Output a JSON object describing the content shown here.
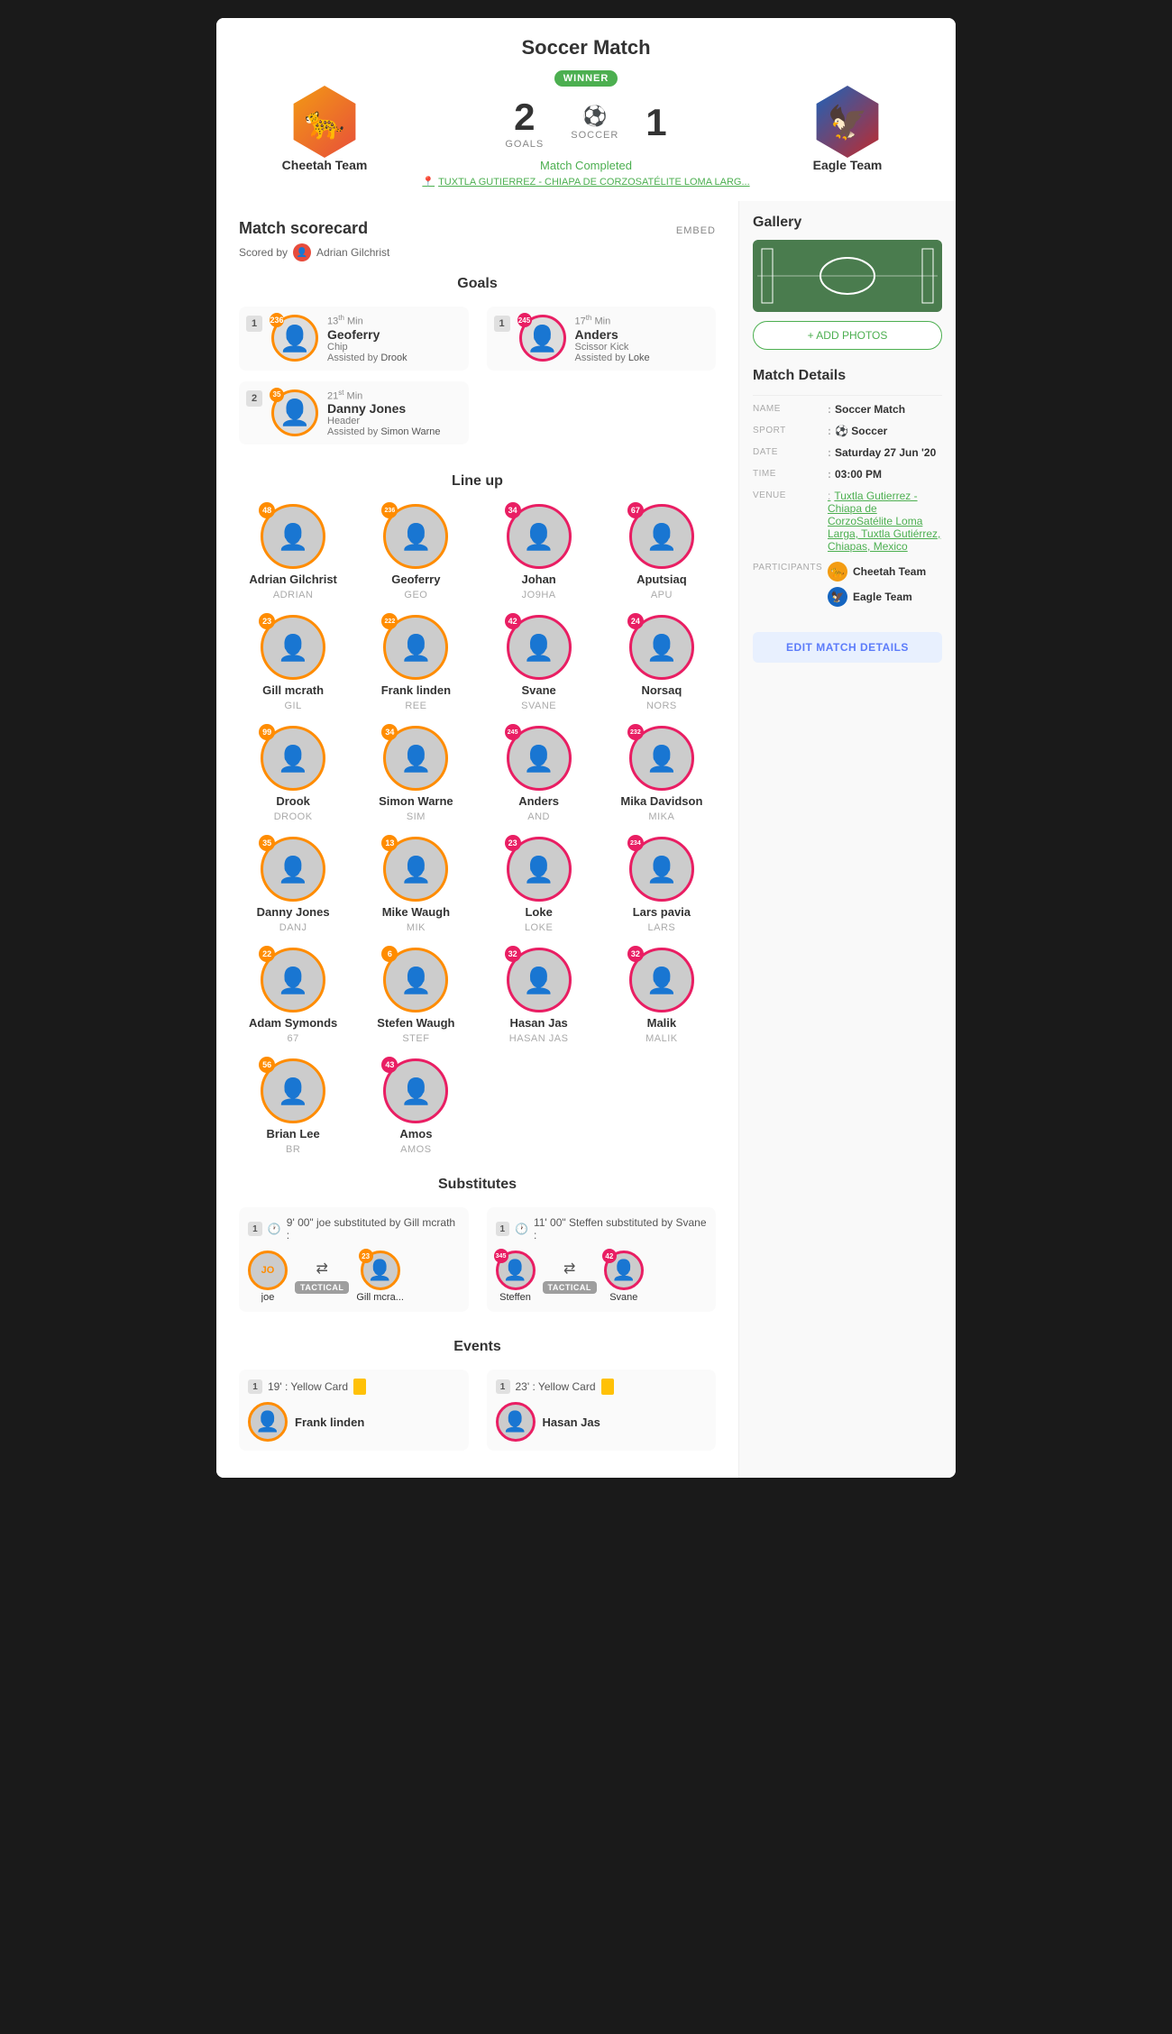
{
  "header": {
    "title": "Soccer Match",
    "team_left": {
      "name": "Cheetah Team",
      "score": "2",
      "goals_label": "GOALS",
      "winner": true,
      "winner_badge": "WINNER"
    },
    "team_right": {
      "name": "Eagle Team",
      "score": "1"
    },
    "sport": "SOCCER",
    "status": "Match Completed",
    "location": "TUXTLA GUTIERREZ - CHIAPA DE CORZOSATÉLITE LOMA LARG...",
    "embed_label": "EMBED"
  },
  "scorecard": {
    "title": "Match scorecard",
    "scored_by_label": "Scored by",
    "scored_by_name": "Adrian Gilchrist",
    "goals_title": "Goals",
    "goals_left": [
      {
        "number": "1",
        "player_num": "236",
        "player_name": "Geoferry",
        "min": "13",
        "min_sup": "th",
        "type": "Chip",
        "assist_label": "Assisted by",
        "assist": "Drook"
      },
      {
        "number": "2",
        "player_num": "35",
        "player_name": "Danny Jones",
        "min": "21",
        "min_sup": "st",
        "type": "Header",
        "assist_label": "Assisted by",
        "assist": "Simon Warne"
      }
    ],
    "goals_right": [
      {
        "number": "1",
        "player_num": "245",
        "player_name": "Anders",
        "min": "17",
        "min_sup": "th",
        "type": "Scissor Kick",
        "assist_label": "Assisted by",
        "assist": "Loke"
      }
    ],
    "lineup_title": "Line up",
    "players": [
      {
        "name": "Adrian Gilchrist",
        "code": "ADRIAN",
        "num": "48",
        "type": "orange"
      },
      {
        "name": "Geoferry",
        "code": "GEO",
        "num": "236",
        "type": "orange"
      },
      {
        "name": "Johan",
        "code": "JO9HA",
        "num": "34",
        "type": "pink"
      },
      {
        "name": "Aputsiaq",
        "code": "APU",
        "num": "67",
        "type": "pink"
      },
      {
        "name": "Gill mcrath",
        "code": "GIL",
        "num": "23",
        "type": "orange"
      },
      {
        "name": "Frank linden",
        "code": "REE",
        "num": "222",
        "type": "orange"
      },
      {
        "name": "Svane",
        "code": "SVANE",
        "num": "42",
        "type": "pink"
      },
      {
        "name": "Norsaq",
        "code": "NORS",
        "num": "24",
        "type": "pink"
      },
      {
        "name": "Drook",
        "code": "DROOK",
        "num": "99",
        "type": "orange"
      },
      {
        "name": "Simon Warne",
        "code": "SIM",
        "num": "34",
        "type": "orange"
      },
      {
        "name": "Anders",
        "code": "AND",
        "num": "245",
        "type": "pink"
      },
      {
        "name": "Mika Davidson",
        "code": "MIKA",
        "num": "232",
        "type": "pink"
      },
      {
        "name": "Danny Jones",
        "code": "DANJ",
        "num": "35",
        "type": "orange"
      },
      {
        "name": "Mike Waugh",
        "code": "MIK",
        "num": "13",
        "type": "orange"
      },
      {
        "name": "Loke",
        "code": "LOKE",
        "num": "23",
        "type": "pink"
      },
      {
        "name": "Lars pavia",
        "code": "LARS",
        "num": "234",
        "type": "pink"
      },
      {
        "name": "Adam Symonds",
        "code": "67",
        "num": "22",
        "type": "orange"
      },
      {
        "name": "Stefen Waugh",
        "code": "STEF",
        "num": "6",
        "type": "orange"
      },
      {
        "name": "Hasan Jas",
        "code": "HASAN JAS",
        "num": "32",
        "type": "pink"
      },
      {
        "name": "Malik",
        "code": "MALIK",
        "num": "32",
        "type": "pink"
      },
      {
        "name": "Brian Lee",
        "code": "BR",
        "num": "56",
        "type": "orange"
      },
      {
        "name": "Amos",
        "code": "AMOS",
        "num": "43",
        "type": "pink"
      }
    ],
    "substitutes_title": "Substitutes",
    "substitutes_left": [
      {
        "number": "1",
        "time": "9' 00\"",
        "description": "joe substituted by Gill mcrath :",
        "from_player": "joe",
        "from_avatar": "JO",
        "to_player": "Gill mcra...",
        "to_num": "23",
        "tactical": true,
        "tactical_label": "TACTICAL"
      }
    ],
    "substitutes_right": [
      {
        "number": "1",
        "time": "11' 00\"",
        "description": "Steffen substituted by Svane :",
        "from_player": "Steffen",
        "from_num": "345",
        "to_player": "Svane",
        "to_num": "42",
        "tactical": true,
        "tactical_label": "TACTICAL"
      }
    ],
    "events_title": "Events",
    "events_left": [
      {
        "number": "1",
        "time": "19'",
        "type": "Yellow Card",
        "player": "Frank linden"
      }
    ],
    "events_right": [
      {
        "number": "1",
        "time": "23'",
        "type": "Yellow Card",
        "player": "Hasan Jas"
      }
    ]
  },
  "gallery": {
    "title": "Gallery",
    "add_photos_label": "+ ADD PHOTOS"
  },
  "match_details": {
    "title": "Match Details",
    "rows": [
      {
        "label": "NAME",
        "value": "Soccer Match",
        "type": "normal"
      },
      {
        "label": "SPORT",
        "value": "⚽ Soccer",
        "type": "normal"
      },
      {
        "label": "DATE",
        "value": "Saturday 27 Jun '20",
        "type": "bold"
      },
      {
        "label": "TIME",
        "value": "03:00 PM",
        "type": "bold"
      },
      {
        "label": "VENUE",
        "value": "Tuxtla Gutierrez - Chiapa de CorzoSatélite Loma Larga, Tuxtla Gutiérrez, Chiapas, Mexico",
        "type": "green"
      }
    ],
    "participants_label": "PARTICIPANTS",
    "teams": [
      {
        "name": "Cheetah Team",
        "icon": "🐆"
      },
      {
        "name": "Eagle Team",
        "icon": "🦅"
      }
    ],
    "edit_button_label": "EDIT MATCH DETAILS"
  }
}
